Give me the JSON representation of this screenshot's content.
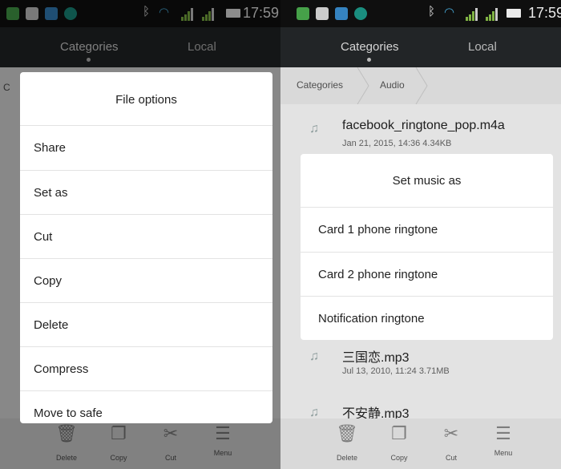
{
  "status": {
    "time": "17:59"
  },
  "tabs": {
    "categories": "Categories",
    "local": "Local"
  },
  "left": {
    "dialog_title": "File options",
    "options": [
      "Share",
      "Set as",
      "Cut",
      "Copy",
      "Delete",
      "Compress",
      "Move to safe"
    ],
    "hidden_crumb_initial": "C"
  },
  "right": {
    "breadcrumb": [
      "Categories",
      "Audio"
    ],
    "files": [
      {
        "name": "facebook_ringtone_pop.m4a",
        "meta": "Jan 21, 2015, 14:36 4.34KB"
      },
      {
        "name": "三国恋.mp3",
        "meta": "Jul 13, 2010, 11:24 3.71MB"
      },
      {
        "name": "不安静.mp3",
        "meta": ""
      }
    ],
    "dialog_title": "Set music as",
    "options": [
      "Card 1 phone ringtone",
      "Card 2 phone ringtone",
      "Notification ringtone"
    ]
  },
  "bottombar": {
    "delete": "Delete",
    "copy": "Copy",
    "cut": "Cut",
    "menu": "Menu"
  },
  "icons": {
    "delete": "trash-icon",
    "copy": "copy-icon",
    "cut": "scissors-icon",
    "menu": "hamburger-icon",
    "file": "music-note-icon"
  },
  "colors": {
    "accent_bar": "#25292b",
    "status_bar": "#111111",
    "signal": "#8bc34a"
  }
}
